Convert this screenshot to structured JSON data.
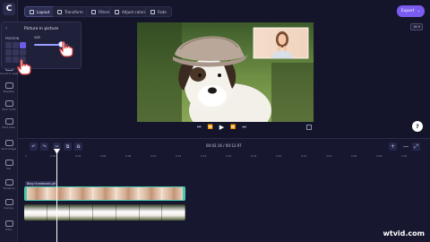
{
  "app": {
    "logo": "C"
  },
  "rail": {
    "items": [
      {
        "label": "Record & create"
      },
      {
        "label": "Templates"
      },
      {
        "label": "Music & SFX"
      },
      {
        "label": "Stock video"
      },
      {
        "label": "Stock images"
      },
      {
        "label": "Text"
      },
      {
        "label": "Transitions"
      },
      {
        "label": "Overlays"
      },
      {
        "label": "Filters"
      }
    ]
  },
  "toolbar": {
    "tabs": [
      {
        "label": "Layout",
        "icon": "layout-icon"
      },
      {
        "label": "Transform",
        "icon": "transform-icon"
      },
      {
        "label": "Filters",
        "icon": "filters-icon"
      },
      {
        "label": "Adjust colors",
        "icon": "adjust-colors-icon"
      },
      {
        "label": "Fade",
        "icon": "fade-icon"
      }
    ],
    "export_label": "Export",
    "export_chevron": "⌄"
  },
  "panel": {
    "back": "‹",
    "title": "Picture in picture",
    "position_label": "POSITION",
    "size_label": "SIZE",
    "size_value": 0.85
  },
  "preview": {
    "ratio_label": "16:9"
  },
  "player": {
    "prev": "⏮",
    "rewind": "⏪",
    "play": "▶",
    "forward": "⏩",
    "next": "⏭"
  },
  "help_label": "?",
  "timeline": {
    "tools": [
      "↶",
      "↷",
      "✂",
      "⧉",
      "♻"
    ],
    "time_display": "00:02.16 / 00:12.97",
    "zoom_in": "+",
    "zoom_out": "−",
    "expand": "⤢",
    "ticks": [
      "0",
      "0:02",
      "0:04",
      "0:06",
      "0:08",
      "0:10",
      "0:12",
      "0:14",
      "0:16",
      "0:18",
      "0:20",
      "0:22",
      "0:24",
      "0:26",
      "0:28",
      "0:30"
    ],
    "pip_track_label": "Blog thumbnails.gif"
  },
  "watermark": "wtvid.com"
}
